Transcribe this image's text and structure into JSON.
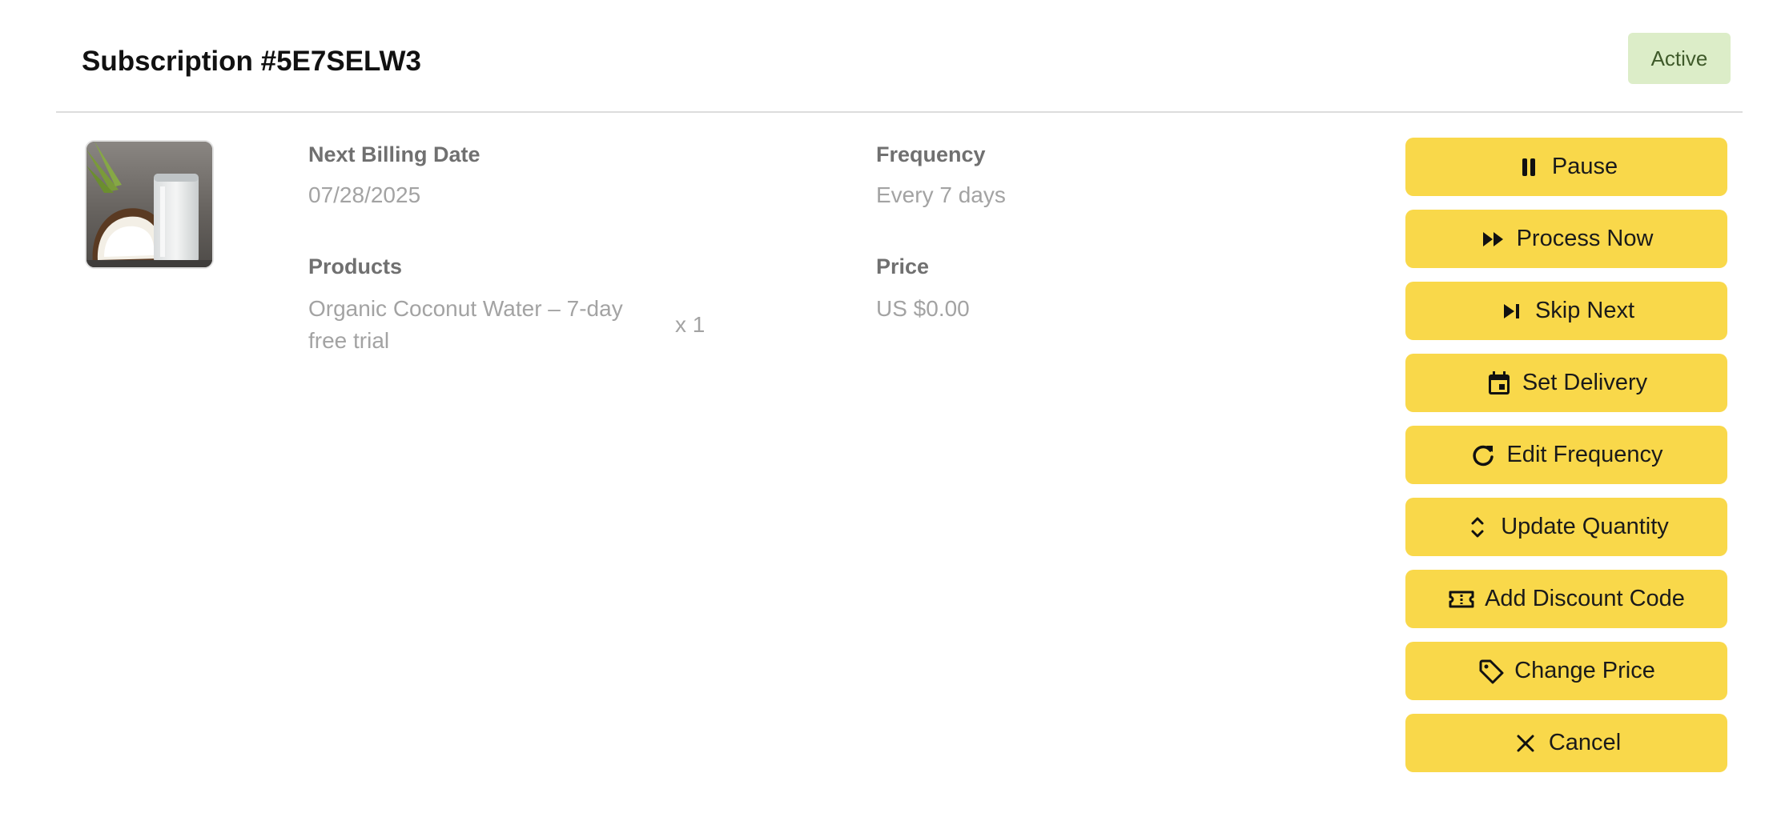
{
  "header": {
    "title": "Subscription #5E7SELW3",
    "status": "Active"
  },
  "details": {
    "next_billing_label": "Next Billing Date",
    "next_billing_value": "07/28/2025",
    "frequency_label": "Frequency",
    "frequency_value": "Every 7 days",
    "products_label": "Products",
    "product_name": "Organic Coconut Water – 7-day free trial",
    "product_qty": "x 1",
    "price_label": "Price",
    "price_value": "US $0.00"
  },
  "actions": [
    {
      "label": "Pause",
      "icon": "pause-icon"
    },
    {
      "label": "Process Now",
      "icon": "fast-forward-icon"
    },
    {
      "label": "Skip Next",
      "icon": "skip-next-icon"
    },
    {
      "label": "Set Delivery",
      "icon": "calendar-icon"
    },
    {
      "label": "Edit Frequency",
      "icon": "refresh-icon"
    },
    {
      "label": "Update Quantity",
      "icon": "up-down-chevron-icon"
    },
    {
      "label": "Add Discount Code",
      "icon": "ticket-icon"
    },
    {
      "label": "Change Price",
      "icon": "tag-icon"
    },
    {
      "label": "Cancel",
      "icon": "close-icon"
    }
  ],
  "colors": {
    "button_bg": "#f9d84a",
    "badge_bg": "#dcedc8",
    "badge_text": "#3f5a2a"
  }
}
